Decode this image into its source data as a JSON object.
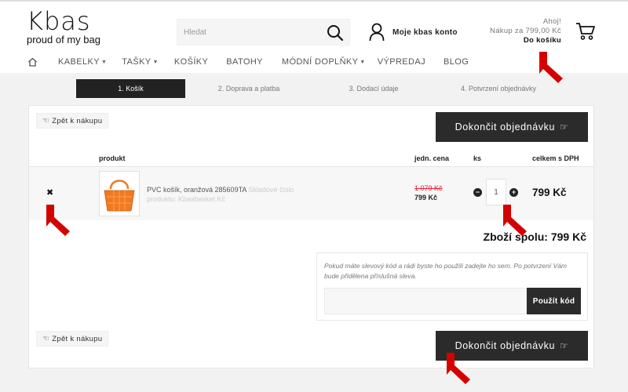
{
  "header": {
    "logo_word": "Kbas",
    "logo_tagline": "proud of my bag",
    "search_placeholder": "Hledat",
    "account_label": "Moje kbas konto",
    "cart_greeting": "Ahoj!",
    "cart_amount": "Nákup za 799,00 Kč",
    "cart_link": "Do košíku"
  },
  "nav": {
    "home_icon": "home-icon",
    "items": [
      {
        "label": "KABELKY",
        "dropdown": true
      },
      {
        "label": "TAŠKY",
        "dropdown": true
      },
      {
        "label": "KOŠÍKY",
        "dropdown": false
      },
      {
        "label": "BATOHY",
        "dropdown": false
      },
      {
        "label": "MÓDNÍ DOPLŇKY",
        "dropdown": true
      },
      {
        "label": "VÝPREDAJ",
        "dropdown": false
      },
      {
        "label": "BLOG",
        "dropdown": false
      }
    ]
  },
  "steps": [
    {
      "label": "1. Košík",
      "active": true
    },
    {
      "label": "2. Doprava a platba",
      "active": false
    },
    {
      "label": "3. Dodací údaje",
      "active": false
    },
    {
      "label": "4. Potvrzení objednávky",
      "active": false
    }
  ],
  "cart": {
    "back_label": "Zpět k nákupu",
    "finish_label": "Dokončit objednávku",
    "columns": {
      "product": "produkt",
      "unit_price": "jedn. cena",
      "qty": "ks",
      "total": "celkem s DPH"
    },
    "items": [
      {
        "name": "PVC košík, oranžová 285609TA",
        "availability": "Skladové číslo produktu: Kbasbasket Kč",
        "old_price": "1 079 Kč",
        "price": "799 Kč",
        "qty": "1",
        "total": "799 Kč"
      }
    ],
    "sum_label": "Zboží spolu: 799 Kč",
    "coupon_text": "Pokud máte slevový kód a rádi byste ho použili zadejte ho sem. Po potvrzení Vám bude přidělena příslušná sleva.",
    "coupon_value": "",
    "coupon_button": "Použít kód"
  },
  "colors": {
    "dark": "#2b2b2b",
    "sale_red": "#e22233",
    "annotation_arrow": "#d40000",
    "product_orange": "#f07a20"
  }
}
